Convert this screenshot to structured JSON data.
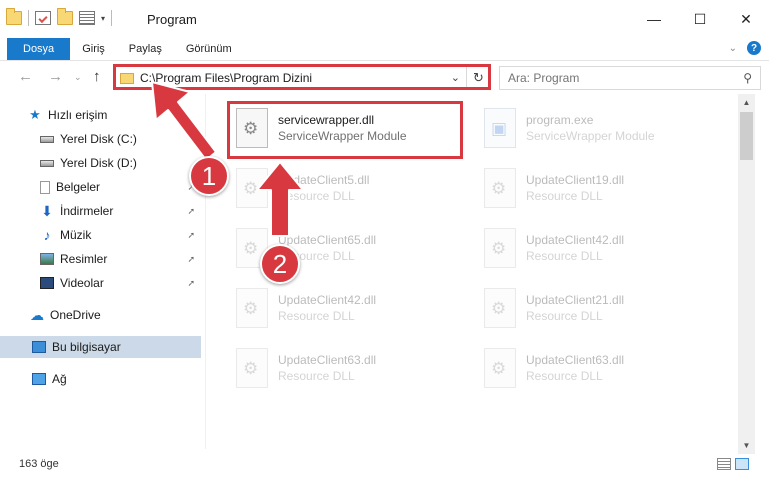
{
  "window": {
    "title": "Program"
  },
  "ribbon": {
    "tabs": [
      "Dosya",
      "Giriş",
      "Paylaş",
      "Görünüm"
    ]
  },
  "address": {
    "path": "C:\\Program Files\\Program Dizini"
  },
  "search": {
    "placeholder": "Ara: Program"
  },
  "sidebar": {
    "items": [
      {
        "label": "Hızlı erişim"
      },
      {
        "label": "Yerel Disk (C:)"
      },
      {
        "label": "Yerel Disk (D:)"
      },
      {
        "label": "Belgeler"
      },
      {
        "label": "İndirmeler"
      },
      {
        "label": "Müzik"
      },
      {
        "label": "Resimler"
      },
      {
        "label": "Videolar"
      },
      {
        "label": "OneDrive"
      },
      {
        "label": "Bu bilgisayar"
      },
      {
        "label": "Ağ"
      }
    ]
  },
  "files": [
    {
      "name": "servicewrapper.dll",
      "desc": "ServiceWrapper Module"
    },
    {
      "name": "program.exe",
      "desc": "ServiceWrapper Module"
    },
    {
      "name": "UpdateClient5.dll",
      "desc": "Resource DLL"
    },
    {
      "name": "UpdateClient19.dll",
      "desc": "Resource DLL"
    },
    {
      "name": "UpdateClient65.dll",
      "desc": "Resource DLL"
    },
    {
      "name": "UpdateClient42.dll",
      "desc": "Resource DLL"
    },
    {
      "name": "UpdateClient42.dll",
      "desc": "Resource DLL"
    },
    {
      "name": "UpdateClient21.dll",
      "desc": "Resource DLL"
    },
    {
      "name": "UpdateClient63.dll",
      "desc": "Resource DLL"
    },
    {
      "name": "UpdateClient63.dll",
      "desc": "Resource DLL"
    }
  ],
  "status": {
    "count": "163 öge"
  },
  "annotations": {
    "step1": "1",
    "step2": "2",
    "color": "#d8383f"
  },
  "icons": {
    "back": "arrow-left-icon",
    "forward": "arrow-right-icon",
    "up": "arrow-up-icon",
    "refresh": "refresh-icon",
    "search": "search-icon",
    "help": "help-icon"
  }
}
